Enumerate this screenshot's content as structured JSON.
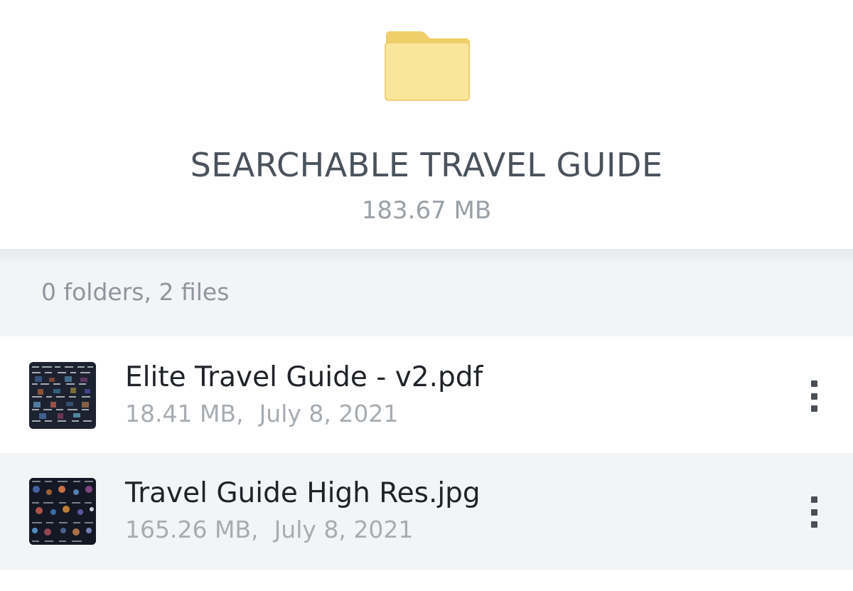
{
  "folder": {
    "icon": "folder-icon",
    "title": "SEARCHABLE TRAVEL GUIDE",
    "size": "183.67 MB",
    "icon_color": "#F7DE8C"
  },
  "summary": {
    "text": "0 folders, 2 files"
  },
  "files": [
    {
      "name": "Elite Travel Guide - v2.pdf",
      "size": "18.41 MB,",
      "date": "July 8, 2021",
      "thumbnail": "pdf-thumbnail",
      "menu_icon": "more-vertical-icon"
    },
    {
      "name": "Travel Guide High Res.jpg",
      "size": "165.26 MB,",
      "date": "July 8, 2021",
      "thumbnail": "image-thumbnail",
      "menu_icon": "more-vertical-icon"
    }
  ],
  "colors": {
    "title_text": "#4A525C",
    "secondary_text": "#9AA0A6",
    "band_background": "#F3F4F6",
    "file_name_text": "#1F2328"
  }
}
